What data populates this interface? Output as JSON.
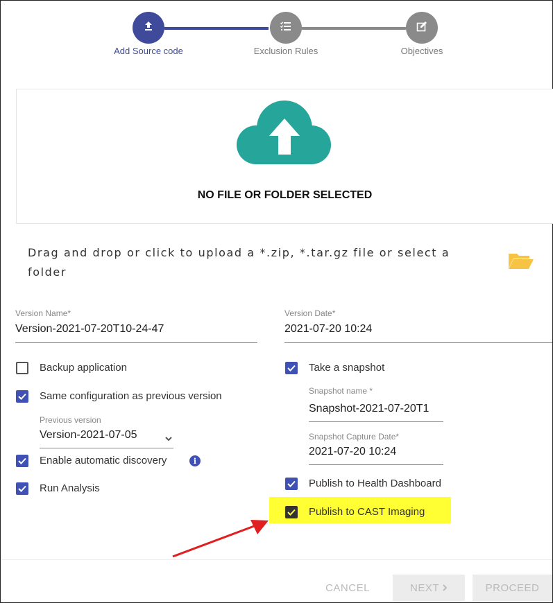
{
  "stepper": {
    "steps": [
      {
        "label": "Add Source code",
        "icon": "upload-icon"
      },
      {
        "label": "Exclusion Rules",
        "icon": "list-icon"
      },
      {
        "label": "Objectives",
        "icon": "edit-icon"
      }
    ]
  },
  "upload": {
    "status": "NO FILE OR FOLDER SELECTED",
    "hint": "Drag and drop or click to upload a *.zip, *.tar.gz file or select a folder",
    "cloud_icon": "cloud-upload-icon",
    "folder_icon": "folder-open-icon"
  },
  "version": {
    "name_label": "Version Name*",
    "name_value": "Version-2021-07-20T10-24-47",
    "date_label": "Version Date*",
    "date_value": "2021-07-20 10:24"
  },
  "left_options": {
    "backup": {
      "label": "Backup application",
      "checked": false
    },
    "same_config": {
      "label": "Same configuration as previous version",
      "checked": true
    },
    "previous_version_label": "Previous version",
    "previous_version_value": "Version-2021-07-05",
    "auto_discovery": {
      "label": "Enable automatic discovery",
      "checked": true
    },
    "run_analysis": {
      "label": "Run Analysis",
      "checked": true
    }
  },
  "right_options": {
    "snapshot": {
      "label": "Take a snapshot",
      "checked": true
    },
    "snapshot_name_label": "Snapshot name *",
    "snapshot_name_value": "Snapshot-2021-07-20T1",
    "snapshot_date_label": "Snapshot Capture Date*",
    "snapshot_date_value": "2021-07-20 10:24",
    "health_dashboard": {
      "label": "Publish to Health Dashboard",
      "checked": true
    },
    "cast_imaging": {
      "label": "Publish to CAST Imaging",
      "checked": true
    }
  },
  "footer": {
    "cancel": "CANCEL",
    "next": "NEXT",
    "proceed": "PROCEED"
  },
  "colors": {
    "active_step": "#3f4a9a",
    "inactive_step": "#8a8a8a",
    "checkbox": "#3f51b5",
    "cloud": "#26a69a",
    "folder": "#f6c344",
    "highlight": "#ffff33",
    "arrow": "#e02020"
  }
}
